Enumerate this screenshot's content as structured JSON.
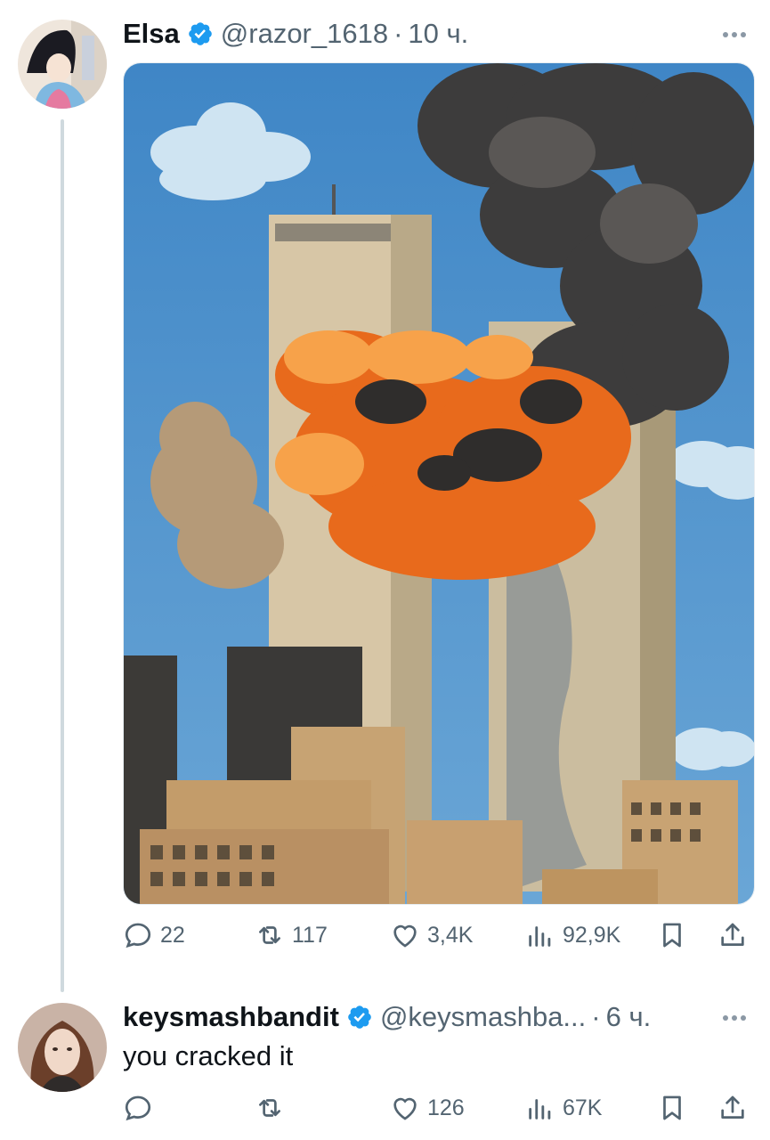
{
  "tweet1": {
    "display_name": "Elsa",
    "handle": "@razor_1618",
    "separator": "·",
    "time": "10 ч.",
    "avatar_icon": "avatar-illustration",
    "image_icon": "tower-explosion-illustration",
    "stats": {
      "replies": "22",
      "retweets": "117",
      "likes": "3,4K",
      "views": "92,9K"
    }
  },
  "tweet2": {
    "display_name": "keysmashbandit",
    "handle": "@keysmashba...",
    "separator": "·",
    "time": "6 ч.",
    "text": "you cracked it",
    "avatar_icon": "avatar-photo",
    "stats": {
      "replies": "",
      "retweets": "",
      "likes": "126",
      "views": "67K"
    }
  },
  "colors": {
    "verified": "#1d9bf0",
    "icon_gray": "#536471",
    "thread_line": "#cfd9de"
  }
}
